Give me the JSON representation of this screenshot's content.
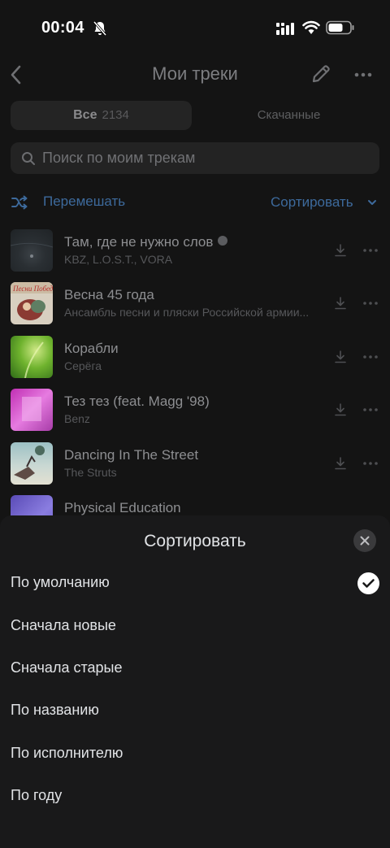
{
  "status_bar": {
    "time": "00:04"
  },
  "header": {
    "title": "Мои треки"
  },
  "tabs": {
    "all_label": "Все",
    "all_count": "2134",
    "downloaded_label": "Скачанные"
  },
  "search": {
    "placeholder": "Поиск по моим трекам"
  },
  "actions": {
    "shuffle_label": "Перемешать",
    "sort_label": "Сортировать"
  },
  "tracks": [
    {
      "title": "Там, где не нужно слов",
      "artist": "KBZ, L.O.S.T., VORA"
    },
    {
      "title": "Весна 45 года",
      "artist": "Ансамбль песни и пляски Российской армии..."
    },
    {
      "title": "Корабли",
      "artist": "Серёга"
    },
    {
      "title": "Тез тез (feat. Magg '98)",
      "artist": "Benz"
    },
    {
      "title": "Dancing In The Street",
      "artist": "The Struts"
    },
    {
      "title": "Physical Education",
      "artist": ""
    }
  ],
  "cover_text": {
    "track_1": "Песни Победы"
  },
  "sort_sheet": {
    "title": "Сортировать",
    "options": [
      "По умолчанию",
      "Сначала новые",
      "Сначала старые",
      "По названию",
      "По исполнителю",
      "По году"
    ],
    "selected_index": 0
  },
  "colors": {
    "accent": "#3d6a9c",
    "sheet_bg": "#19191a",
    "page_bg": "#141414"
  },
  "icons": [
    "bell-slash-icon",
    "signal-icon",
    "wifi-icon",
    "battery-icon",
    "back-icon",
    "pencil-icon",
    "more-icon",
    "search-icon",
    "shuffle-icon",
    "chevron-down-icon",
    "download-icon",
    "close-icon",
    "checkmark-icon"
  ]
}
